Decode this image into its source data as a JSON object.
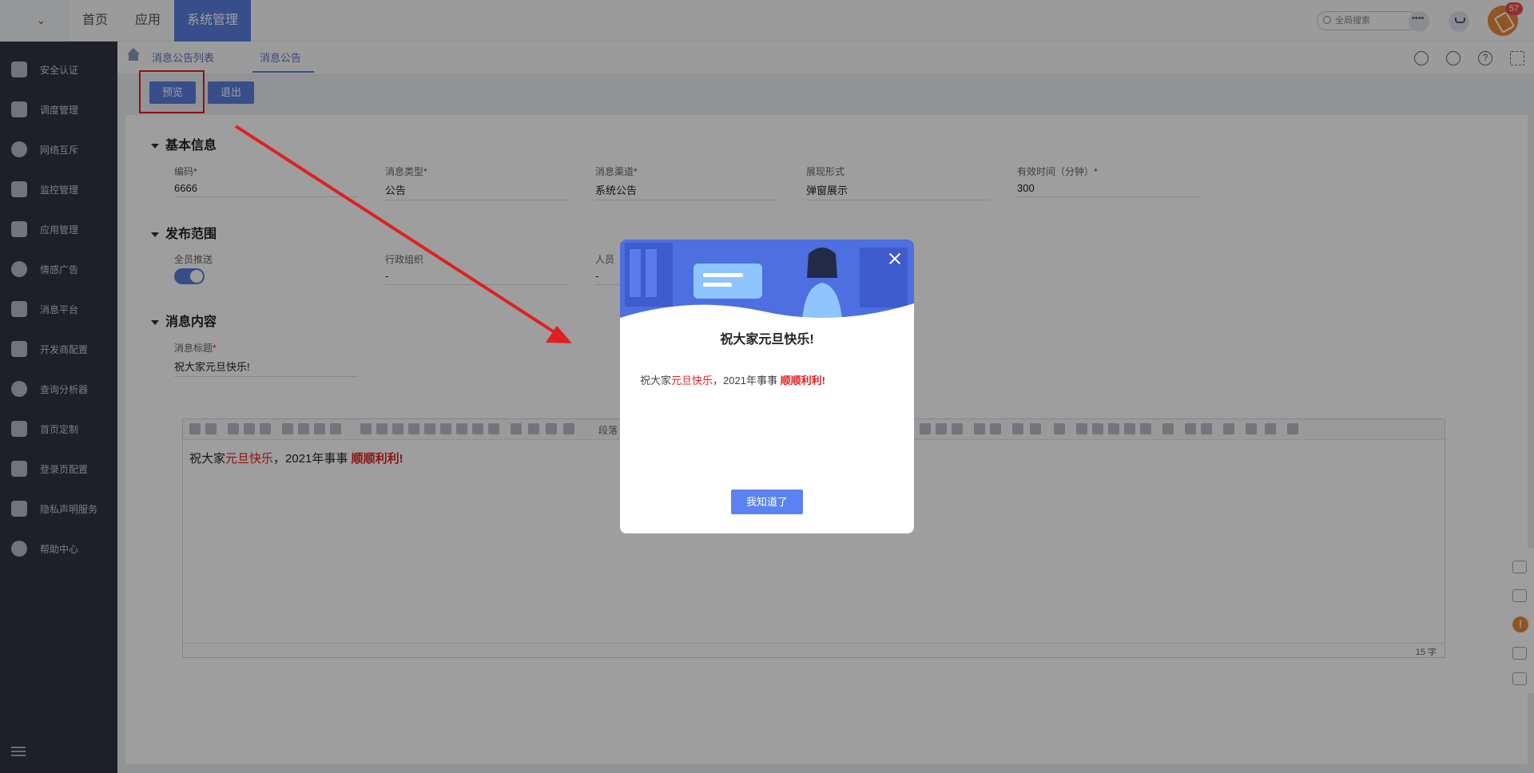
{
  "topbar": {
    "nav": [
      "首页",
      "应用",
      "系统管理"
    ],
    "active_nav_index": 2,
    "search_placeholder": "全局搜索",
    "notification_count": "57"
  },
  "sidebar": {
    "items": [
      {
        "label": "安全认证",
        "icon": "shield-icon"
      },
      {
        "label": "调度管理",
        "icon": "schedule-icon"
      },
      {
        "label": "网络互斥",
        "icon": "globe-icon"
      },
      {
        "label": "监控管理",
        "icon": "monitor-icon"
      },
      {
        "label": "应用管理",
        "icon": "apps-grid-icon"
      },
      {
        "label": "情感广告",
        "icon": "heart-icon"
      },
      {
        "label": "消息平台",
        "icon": "message-icon"
      },
      {
        "label": "开发商配置",
        "icon": "building-gear-icon"
      },
      {
        "label": "查询分析器",
        "icon": "search-icon"
      },
      {
        "label": "首页定制",
        "icon": "home-icon"
      },
      {
        "label": "登录页配置",
        "icon": "building-gear-icon"
      },
      {
        "label": "隐私声明服务",
        "icon": "desktop-icon"
      },
      {
        "label": "帮助中心",
        "icon": "help-icon"
      }
    ]
  },
  "tabs": [
    "消息公告列表",
    "消息公告"
  ],
  "actions": {
    "preview": "预览",
    "exit": "退出"
  },
  "sections": {
    "basic": "基本信息",
    "scope": "发布范围",
    "content": "消息内容"
  },
  "basic_fields": [
    {
      "label": "编码",
      "required": true,
      "value": "6666"
    },
    {
      "label": "消息类型",
      "required": true,
      "value": "公告"
    },
    {
      "label": "消息渠道",
      "required": true,
      "value": "系统公告"
    },
    {
      "label": "展现形式",
      "required": false,
      "value": "弹窗展示"
    },
    {
      "label": "有效时间（分钟）",
      "required": true,
      "value": "300"
    }
  ],
  "scope_fields": {
    "all_push_label": "全员推送",
    "all_push_on": true,
    "org_label": "行政组织",
    "org_value": "-",
    "person_label": "人员",
    "person_value": "-"
  },
  "content_fields": {
    "title_label": "消息标题",
    "title_value": "祝大家元旦快乐!",
    "toolbar_paragraph": "段落",
    "body_part1": "祝大家",
    "body_part2": "元旦快乐",
    "body_part3": "，2021年事事 ",
    "body_part4": "顺顺利利!",
    "char_count": "15 字"
  },
  "modal": {
    "title": "祝大家元旦快乐!",
    "body_part1": "祝大家",
    "body_part2": "元旦快乐",
    "body_part3": "，2021年事事 ",
    "body_part4": "顺顺利利!",
    "confirm": "我知道了"
  },
  "colors": {
    "accent": "#5b7fdf",
    "sidebar_bg": "#303440",
    "highlight_red": "#e02020",
    "badge": "#f04848"
  }
}
